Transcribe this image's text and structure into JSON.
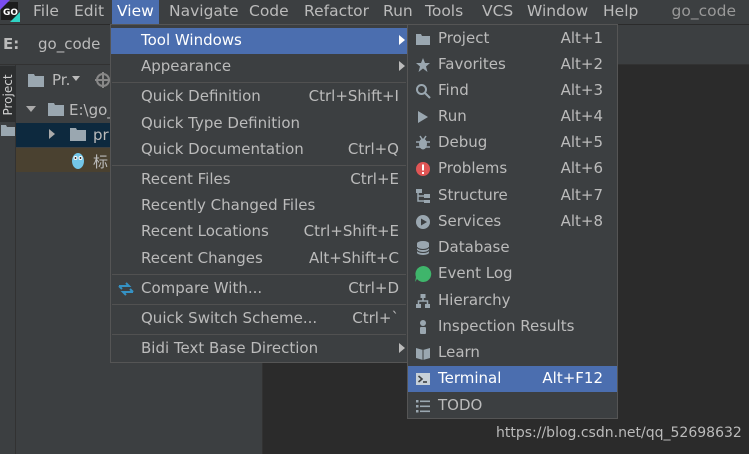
{
  "menubar": {
    "items": [
      "File",
      "Edit",
      "View",
      "Navigate",
      "Code",
      "Refactor",
      "Run",
      "Tools",
      "VCS",
      "Window",
      "Help"
    ],
    "active": "View",
    "project_title": "go_code"
  },
  "breadcrumb": {
    "drive": "E:",
    "project": "go_code"
  },
  "tool_strip": {
    "project_tab": "Project"
  },
  "project_panel": {
    "title": "Pr.",
    "tree": [
      {
        "label": "E:\\go_"
      },
      {
        "label": "pr"
      },
      {
        "label": "标"
      }
    ]
  },
  "view_menu": {
    "items": [
      {
        "label": "Tool Windows",
        "shortcut": "",
        "submenu": true,
        "selected": true
      },
      {
        "label": "Appearance",
        "shortcut": "",
        "submenu": true
      },
      {
        "label": "Quick Definition",
        "shortcut": "Ctrl+Shift+I"
      },
      {
        "label": "Quick Type Definition",
        "shortcut": ""
      },
      {
        "label": "Quick Documentation",
        "shortcut": "Ctrl+Q"
      },
      {
        "label": "Recent Files",
        "shortcut": "Ctrl+E"
      },
      {
        "label": "Recently Changed Files",
        "shortcut": ""
      },
      {
        "label": "Recent Locations",
        "shortcut": "Ctrl+Shift+E"
      },
      {
        "label": "Recent Changes",
        "shortcut": "Alt+Shift+C"
      },
      {
        "label": "Compare With...",
        "shortcut": "Ctrl+D",
        "icon": "compare-arrows-icon"
      },
      {
        "label": "Quick Switch Scheme...",
        "shortcut": "Ctrl+`"
      },
      {
        "label": "Bidi Text Base Direction",
        "shortcut": "",
        "submenu": true
      }
    ]
  },
  "tool_windows_menu": {
    "items": [
      {
        "label": "Project",
        "shortcut": "Alt+1",
        "icon": "folder-icon"
      },
      {
        "label": "Favorites",
        "shortcut": "Alt+2",
        "icon": "star-icon"
      },
      {
        "label": "Find",
        "shortcut": "Alt+3",
        "icon": "search-icon"
      },
      {
        "label": "Run",
        "shortcut": "Alt+4",
        "icon": "play-icon"
      },
      {
        "label": "Debug",
        "shortcut": "Alt+5",
        "icon": "bug-icon"
      },
      {
        "label": "Problems",
        "shortcut": "Alt+6",
        "icon": "error-icon"
      },
      {
        "label": "Structure",
        "shortcut": "Alt+7",
        "icon": "structure-icon"
      },
      {
        "label": "Services",
        "shortcut": "Alt+8",
        "icon": "services-icon"
      },
      {
        "label": "Database",
        "shortcut": "",
        "icon": "database-icon"
      },
      {
        "label": "Event Log",
        "shortcut": "",
        "icon": "event-log-icon"
      },
      {
        "label": "Hierarchy",
        "shortcut": "",
        "icon": "hierarchy-icon"
      },
      {
        "label": "Inspection Results",
        "shortcut": "",
        "icon": "inspection-icon"
      },
      {
        "label": "Learn",
        "shortcut": "",
        "icon": "learn-icon"
      },
      {
        "label": "Terminal",
        "shortcut": "Alt+F12",
        "icon": "terminal-icon",
        "selected": true
      },
      {
        "label": "TODO",
        "shortcut": "",
        "icon": "todo-icon"
      }
    ]
  },
  "colors": {
    "menu_bg": "#3c3f41",
    "editor_bg": "#2b2b2b",
    "selection": "#4b6eaf",
    "text": "#bbbbbb",
    "error_red": "#e05555",
    "event_green": "#3fb56b",
    "compare_blue": "#3592c4"
  },
  "watermark": "https://blog.csdn.net/qq_52698632"
}
